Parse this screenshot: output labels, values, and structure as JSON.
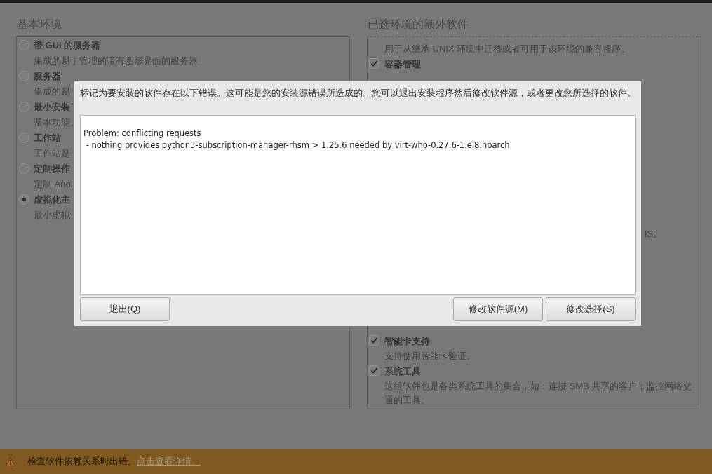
{
  "base_environment": {
    "heading": "基本环境",
    "options": [
      {
        "title": "带 GUI 的服务器",
        "description": "集成的易于管理的带有图形界面的服务器",
        "selected": false
      },
      {
        "title": "服务器",
        "description": "集成的易",
        "selected": false
      },
      {
        "title": "最小安装",
        "description": "基本功能。",
        "selected": false
      },
      {
        "title": "工作站",
        "description": "工作站是",
        "selected": false
      },
      {
        "title": "定制操作",
        "description": "定制 Anol",
        "selected": false
      },
      {
        "title": "虚拟化主",
        "description": "最小虚拟",
        "selected": true
      }
    ]
  },
  "extra_software": {
    "heading": "已选环境的额外软件",
    "items": [
      {
        "kind": "description",
        "description": "用于从继承 UNIX 环境中迁移或者可用于该环境的兼容程序。"
      },
      {
        "kind": "group",
        "name": "容器管理",
        "checked": true
      },
      {
        "kind": "fragment",
        "description": "IS。"
      },
      {
        "kind": "group",
        "name": "智能卡支持",
        "checked": true,
        "description": "支持使用智能卡验证。"
      },
      {
        "kind": "group",
        "name": "系统工具",
        "checked": true,
        "description": "这组软件包是各类系统工具的集合，如：连接 SMB 共享的客户；监控网络交通的工具。"
      }
    ]
  },
  "dialog": {
    "message": "标记为要安装的软件存在以下错误。这可能是您的安装源错误所造成的。您可以退出安装程序然后修改软件源，或者更改您所选择的软件。",
    "details": "Problem: conflicting requests\n - nothing provides python3-subscription-manager-rhsm > 1.25.6 needed by virt-who-0.27.6-1.el8.noarch",
    "buttons_left": [
      {
        "label": "退出(Q)"
      }
    ],
    "buttons_right": [
      {
        "label": "修改软件源(M)"
      },
      {
        "label": "修改选择(S)"
      }
    ]
  },
  "status_bar": {
    "message": "检查软件依赖关系时出错。",
    "link": "点击查看详情。"
  }
}
